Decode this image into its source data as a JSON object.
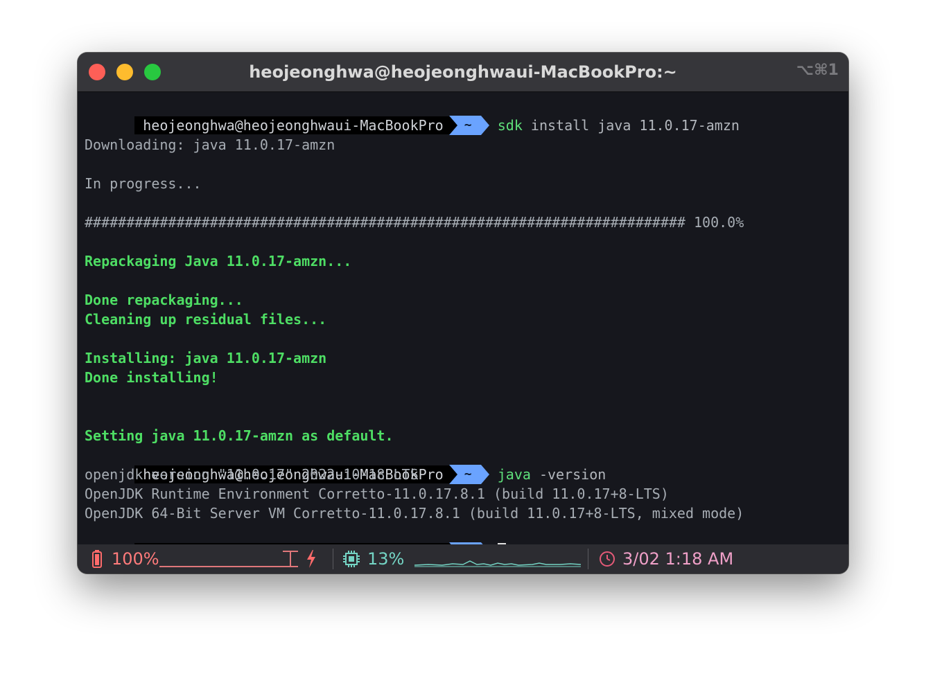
{
  "window": {
    "title": "heojeonghwa@heojeonghwaui-MacBookPro:~",
    "shortcut": "⌥⌘1"
  },
  "prompt": {
    "user_host": "heojeonghwa@heojeonghwaui-MacBookPro",
    "dir": "~"
  },
  "terminal": {
    "cmd1_main": "sdk",
    "cmd1_args": " install java 11.0.17-amzn",
    "downloading": "Downloading: java 11.0.17-amzn",
    "in_progress": "In progress...",
    "progress_bar": "######################################################################## 100.0%",
    "repackaging": "Repackaging Java 11.0.17-amzn...",
    "done_repackaging": "Done repackaging...",
    "cleaning": "Cleaning up residual files...",
    "installing": "Installing: java 11.0.17-amzn",
    "done_installing": "Done installing!",
    "setting_default": "Setting java 11.0.17-amzn as default.",
    "cmd2_main": "java",
    "cmd2_args": " -version",
    "out1": "openjdk version \"11.0.17\" 2022-10-18 LTS",
    "out2": "OpenJDK Runtime Environment Corretto-11.0.17.8.1 (build 11.0.17+8-LTS)",
    "out3": "OpenJDK 64-Bit Server VM Corretto-11.0.17.8.1 (build 11.0.17+8-LTS, mixed mode)"
  },
  "status_bar": {
    "battery_pct": "100%",
    "battery_level": 1.0,
    "cpu_pct": "13%",
    "datetime": "3/02 1:18 AM",
    "icons": [
      "battery-icon",
      "charging-bolt-icon",
      "cpu-chip-icon",
      "clock-icon"
    ],
    "colors": {
      "battery": "#ff6b6b",
      "cpu": "#74d4c4",
      "clock": "#f0a0c8"
    }
  },
  "colors": {
    "background": "#16171d",
    "prompt_arrow": "#6aa3ff",
    "success_text": "#4ede64",
    "plain_text": "#a7adb4"
  }
}
